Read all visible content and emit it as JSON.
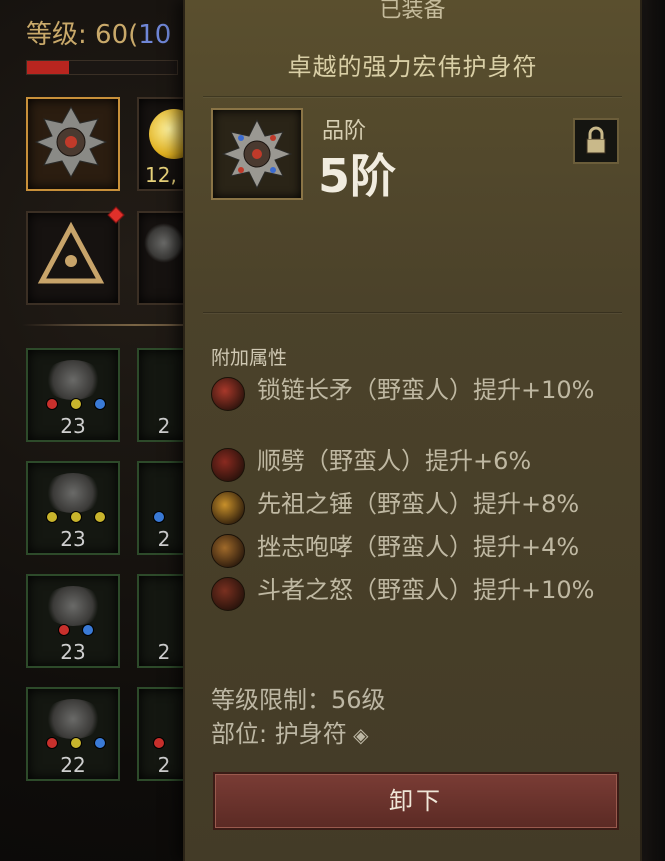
{
  "character": {
    "level_label": "等级: 60(",
    "level_paren": "10"
  },
  "xp_fill_fraction": 0.28,
  "inventory": {
    "gold_count": "12,",
    "slot_numbers": [
      "23",
      "2",
      "23",
      "2",
      "23",
      "2",
      "22",
      "2"
    ]
  },
  "tooltip": {
    "header": "已装备",
    "item_name": "卓越的强力宏伟护身符",
    "quality_label": "品阶",
    "quality_value": "5阶",
    "section_title": "附加属性",
    "affixes": [
      {
        "text": "锁链长矛（野蛮人）提升+10%",
        "icon": "chain-spear-skill-icon",
        "color": "#a8382a"
      },
      {
        "text": "顺劈（野蛮人）提升+6%",
        "icon": "cleave-skill-icon",
        "color": "#8a2a20"
      },
      {
        "text": "先祖之锤（野蛮人）提升+8%",
        "icon": "ancient-hammer-skill-icon",
        "color": "#c8902a"
      },
      {
        "text": "挫志咆哮（野蛮人）提升+4%",
        "icon": "threatening-shout-skill-icon",
        "color": "#a06a2a"
      },
      {
        "text": "斗者之怒（野蛮人）提升+10%",
        "icon": "wrath-skill-icon",
        "color": "#7a3020"
      }
    ],
    "level_req": "等级限制：56级",
    "slot": "部位: 护身符",
    "unequip_label": "卸下"
  }
}
